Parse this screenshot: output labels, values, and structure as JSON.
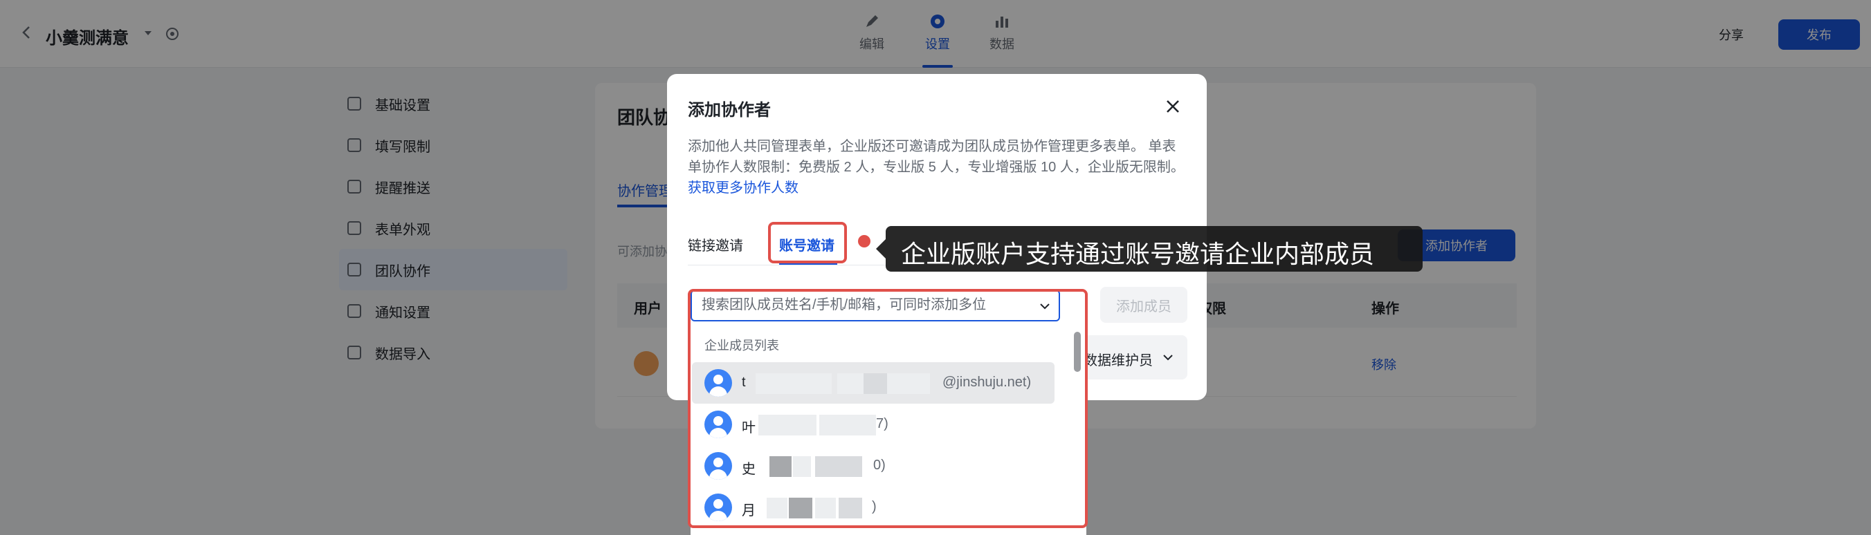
{
  "app": {
    "form_title": "小羹测满意",
    "nav": [
      {
        "label": "编辑"
      },
      {
        "label": "设置"
      },
      {
        "label": "数据"
      }
    ],
    "share_label": "分享",
    "publish_label": "发布"
  },
  "sidebar": {
    "items": [
      {
        "label": "基础设置"
      },
      {
        "label": "填写限制"
      },
      {
        "label": "提醒推送"
      },
      {
        "label": "表单外观"
      },
      {
        "label": "团队协作"
      },
      {
        "label": "通知设置"
      },
      {
        "label": "数据导入"
      }
    ]
  },
  "page": {
    "heading": "团队协作",
    "tab": "协作管理",
    "hint": "可添加协作者共同管理表单",
    "add_button": "添加协作者",
    "table_headers": [
      "用户",
      "权限",
      "操作"
    ],
    "row_op": "移除"
  },
  "modal": {
    "title": "添加协作者",
    "description": "添加他人共同管理表单，企业版还可邀请成为团队成员协作管理更多表单。 单表单协作人数限制：免费版 2 人，专业版 5 人，专业增强版 10 人，企业版无限制。",
    "description_link": "获取更多协作人数",
    "tabs": [
      {
        "label": "链接邀请"
      },
      {
        "label": "账号邀请"
      }
    ],
    "search": {
      "placeholder": "搜索团队成员姓名/手机/邮箱，可同时添加多位",
      "value": ""
    },
    "add_member_label": "添加成员",
    "role_label": "数据维护员"
  },
  "dropdown": {
    "title": "企业成员列表",
    "members": [
      {
        "name": "t",
        "suffix": "@jinshuju.net)"
      },
      {
        "name": "叶",
        "suffix": "7)"
      },
      {
        "name": "史",
        "suffix": "0)"
      },
      {
        "name": "月",
        "suffix": ")"
      }
    ]
  },
  "annotation": {
    "text": "企业版账户支持通过账号邀请企业内部成员"
  },
  "colors": {
    "accent": "#1a56db",
    "highlight": "#e0504a",
    "avatar": "#3b82f6"
  }
}
